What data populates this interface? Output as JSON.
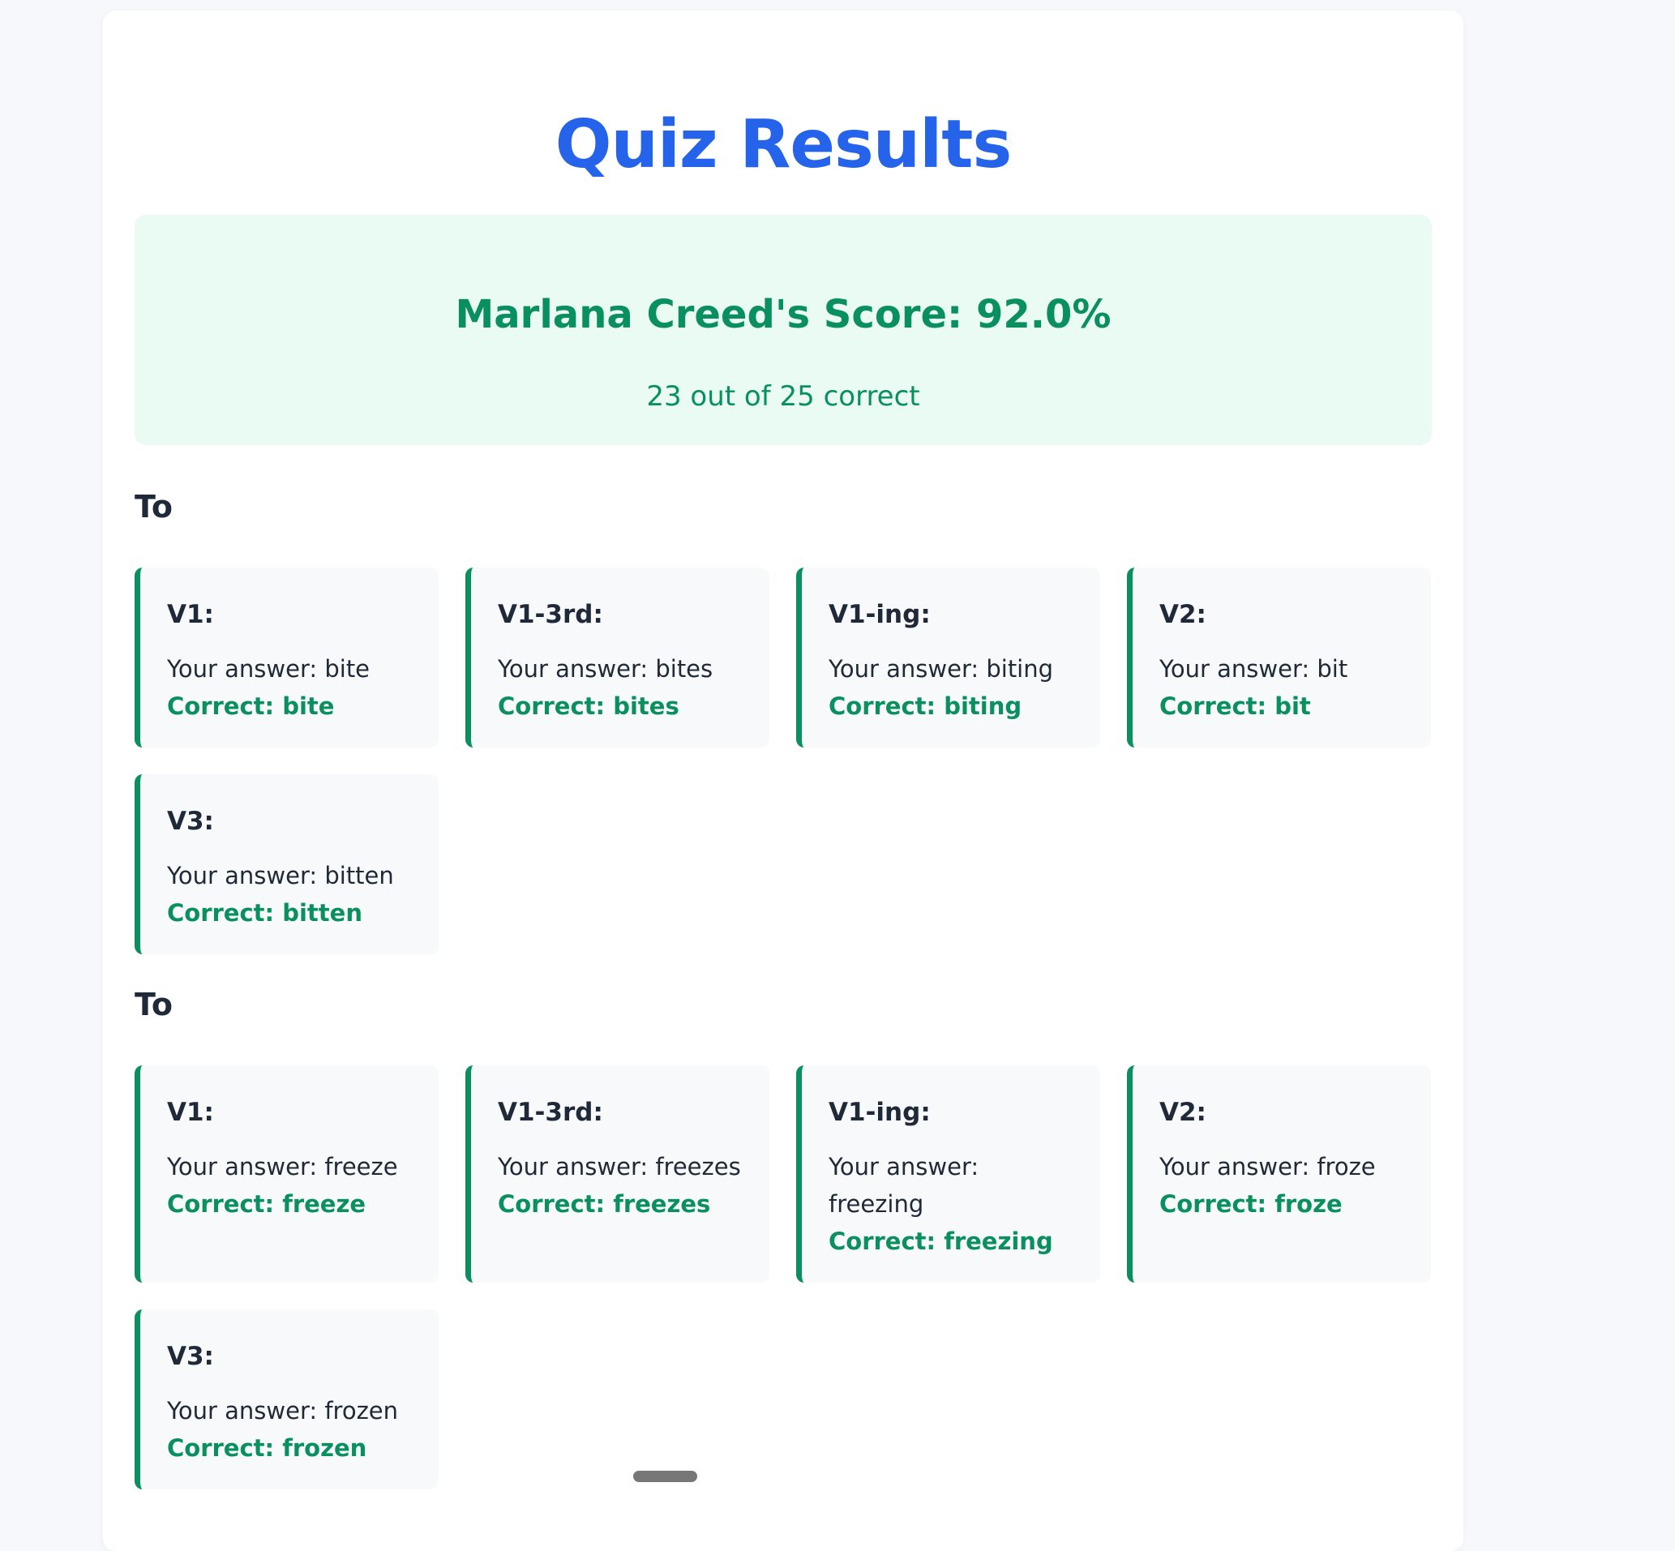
{
  "page": {
    "title": "Quiz Results"
  },
  "score": {
    "title": "Marlana Creed's Score: 92.0%",
    "summary": "23 out of 25 correct"
  },
  "sections": [
    {
      "heading": "To",
      "items": [
        {
          "label": "V1:",
          "answer": "Your answer: bite",
          "correct": "Correct: bite"
        },
        {
          "label": "V1-3rd:",
          "answer": "Your answer: bites",
          "correct": "Correct: bites"
        },
        {
          "label": "V1-ing:",
          "answer": "Your answer: biting",
          "correct": "Correct: biting"
        },
        {
          "label": "V2:",
          "answer": "Your answer: bit",
          "correct": "Correct: bit"
        },
        {
          "label": "V3:",
          "answer": "Your answer: bitten",
          "correct": "Correct: bitten"
        }
      ]
    },
    {
      "heading": "To",
      "items": [
        {
          "label": "V1:",
          "answer": "Your answer: freeze",
          "correct": "Correct: freeze"
        },
        {
          "label": "V1-3rd:",
          "answer": "Your answer: freezes",
          "correct": "Correct: freezes"
        },
        {
          "label": "V1-ing:",
          "answer": "Your answer: freezing",
          "correct": "Correct: freezing"
        },
        {
          "label": "V2:",
          "answer": "Your answer: froze",
          "correct": "Correct: froze"
        },
        {
          "label": "V3:",
          "answer": "Your answer: frozen",
          "correct": "Correct: frozen"
        }
      ]
    }
  ],
  "colors": {
    "accent": "#2563eb",
    "success": "#0a8f5f",
    "success_bg": "#eafbf3",
    "card_bg": "#f7f9fb",
    "page_bg": "#f6f8fb"
  }
}
